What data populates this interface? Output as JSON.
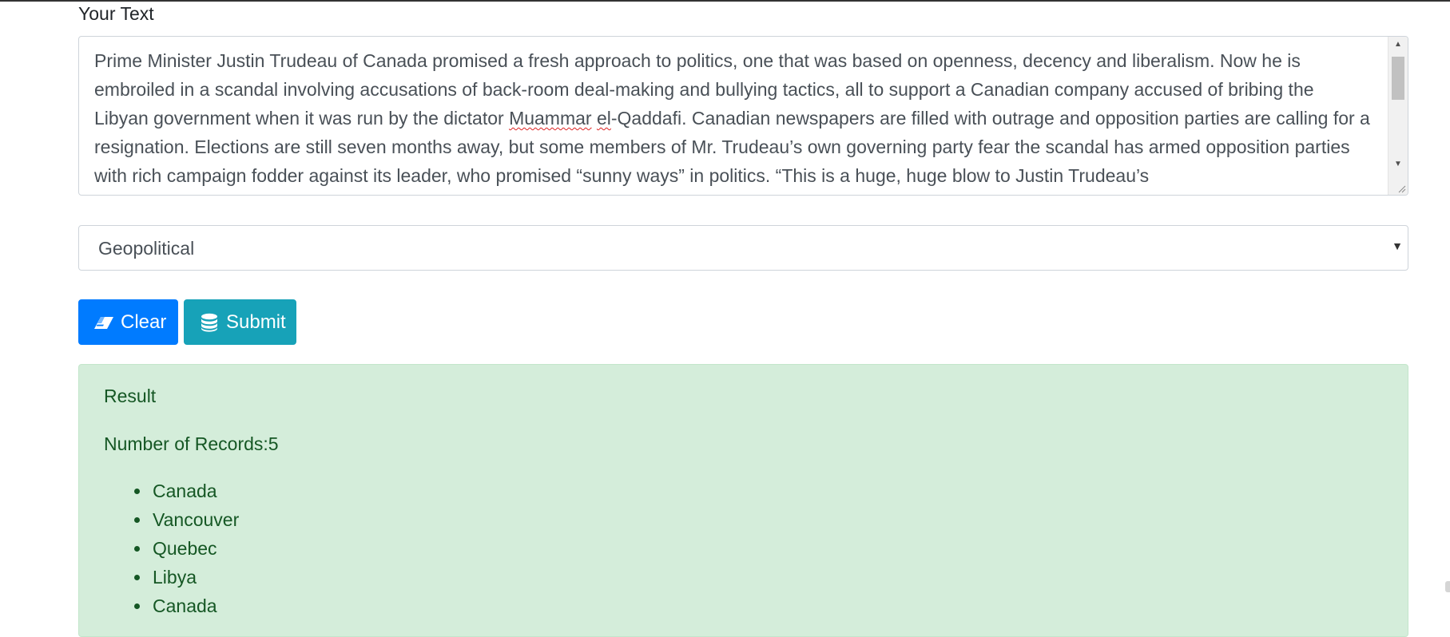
{
  "form": {
    "text_label": "Your Text",
    "text_parts": [
      "Prime Minister Justin Trudeau of Canada promised a fresh approach to politics, one that was based on openness, decency and liberalism. Now he is embroiled in a scandal involving accusations of back-room deal-making and bullying tactics, all to support a Canadian company accused of bribing the Libyan government when it was run by the dictator ",
      "Muammar",
      " ",
      "el",
      "-Qaddafi. Canadian newspapers are filled with outrage and opposition parties are calling for a resignation. Elections are still seven months away, but some members of Mr. Trudeau’s own governing party fear the scandal has armed opposition parties with rich campaign fodder against its leader, who promised “sunny ways” in politics. “This is a huge, huge blow to Justin Trudeau’s"
    ],
    "category_selected": "Geopolitical",
    "clear_label": "Clear",
    "submit_label": "Submit",
    "clear_icon": "eraser-icon",
    "submit_icon": "database-icon"
  },
  "result": {
    "title": "Result",
    "count_text": "Number of Records:5",
    "records": [
      "Canada",
      "Vancouver",
      "Quebec",
      "Libya",
      "Canada"
    ]
  },
  "colors": {
    "primary": "#007bff",
    "info": "#17a2b8",
    "success_bg": "#d4edda",
    "success_text": "#155724"
  }
}
